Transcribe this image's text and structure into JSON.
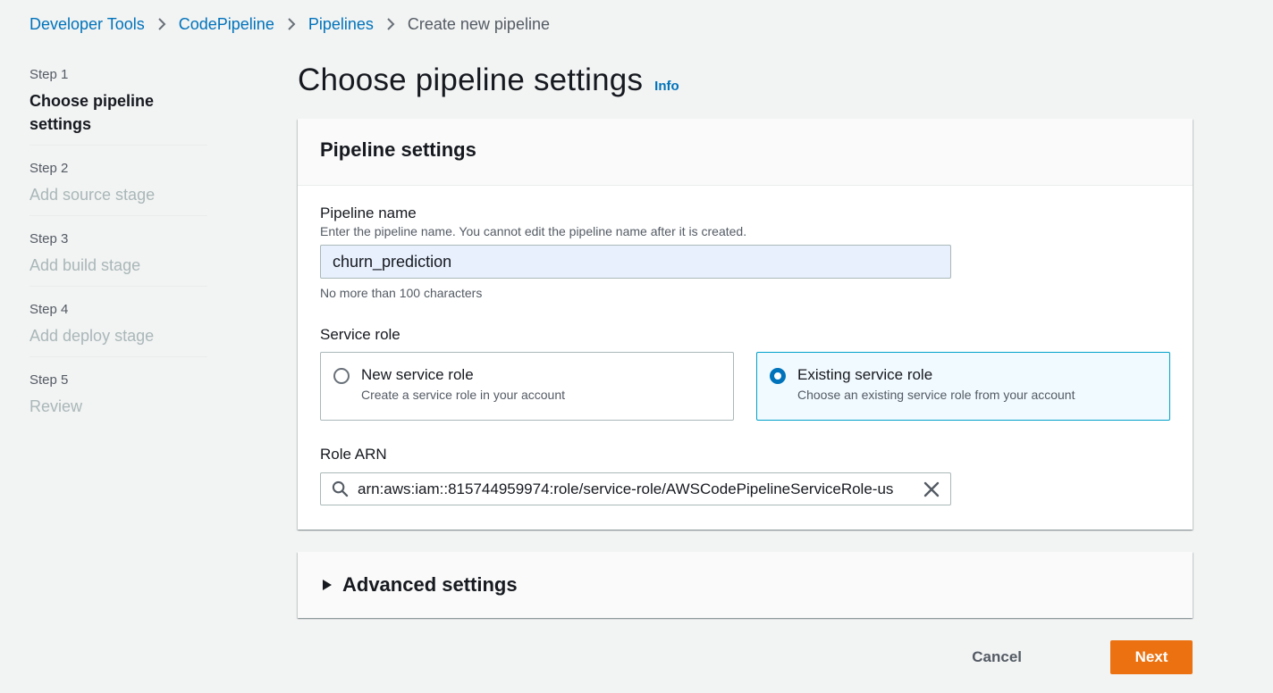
{
  "breadcrumb": {
    "items": [
      "Developer Tools",
      "CodePipeline",
      "Pipelines"
    ],
    "current": "Create new pipeline"
  },
  "steps": [
    {
      "num": "Step 1",
      "title": "Choose pipeline settings",
      "active": true
    },
    {
      "num": "Step 2",
      "title": "Add source stage",
      "active": false
    },
    {
      "num": "Step 3",
      "title": "Add build stage",
      "active": false
    },
    {
      "num": "Step 4",
      "title": "Add deploy stage",
      "active": false
    },
    {
      "num": "Step 5",
      "title": "Review",
      "active": false
    }
  ],
  "page": {
    "title": "Choose pipeline settings",
    "info_label": "Info"
  },
  "pipeline_settings": {
    "title": "Pipeline settings",
    "name_label": "Pipeline name",
    "name_description": "Enter the pipeline name. You cannot edit the pipeline name after it is created.",
    "name_value": "churn_prediction",
    "name_constraint": "No more than 100 characters",
    "service_role_label": "Service role",
    "roles": [
      {
        "title": "New service role",
        "description": "Create a service role in your account",
        "selected": false
      },
      {
        "title": "Existing service role",
        "description": "Choose an existing service role from your account",
        "selected": true
      }
    ],
    "arn_label": "Role ARN",
    "arn_value": "arn:aws:iam::815744959974:role/service-role/AWSCodePipelineServiceRole-us"
  },
  "advanced": {
    "title": "Advanced settings"
  },
  "actions": {
    "cancel_label": "Cancel",
    "next_label": "Next"
  },
  "colors": {
    "link": "#0073bb",
    "primary_button": "#ec7211",
    "selected_tile_border": "#00a1c9"
  }
}
